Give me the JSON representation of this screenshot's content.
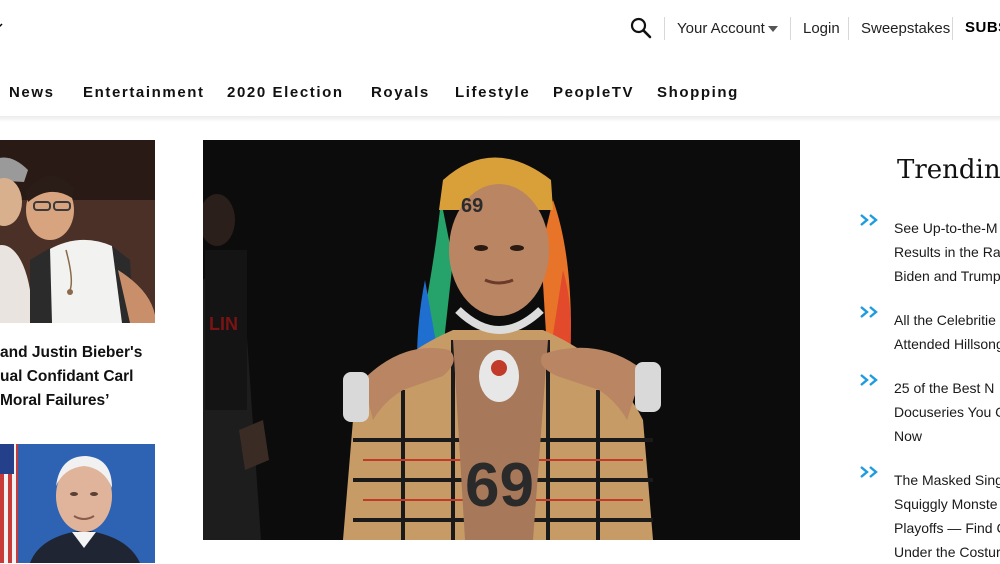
{
  "header": {
    "icons": {
      "search": "search-icon",
      "account_menu": "chevron-down-icon"
    },
    "account_label": "Your Account",
    "login_label": "Login",
    "sweepstakes_label": "Sweepstakes",
    "subscribe_label": "SUBS"
  },
  "nav": {
    "items": [
      "News",
      "Entertainment",
      "2020 Election",
      "Royals",
      "Lifestyle",
      "PeopleTV",
      "Shopping"
    ]
  },
  "left_column": {
    "headline_lines": [
      "and Justin Bieber's",
      "ual Confidant Carl",
      "Moral Failures’"
    ]
  },
  "trending": {
    "title": "Trending",
    "accent_color": "#1c9be0",
    "items": [
      {
        "lines": [
          "See Up-to-the-M",
          "Results in the Rac",
          "Biden and Trump"
        ]
      },
      {
        "lines": [
          "All the Celebritie",
          "Attended Hillsong"
        ]
      },
      {
        "lines": [
          "25 of the Best N",
          "Docuseries You C",
          "Now"
        ]
      },
      {
        "lines": [
          "The Masked Sing",
          "Squiggly Monste",
          "Playoffs — Find C",
          "Under the Costur"
        ]
      }
    ]
  }
}
